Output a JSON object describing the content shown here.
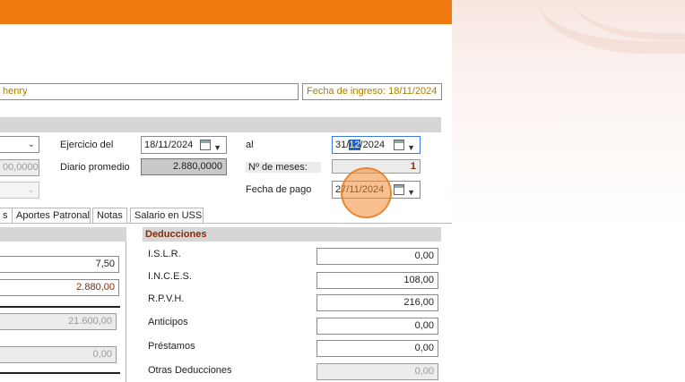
{
  "header": {
    "employee_name_partial": "henry",
    "hire_date_label": "Fecha de ingreso: 18/11/2024"
  },
  "top_left": {
    "amount_partial": "00,0000"
  },
  "period": {
    "ejercicio_label": "Ejercicio del",
    "ejercicio_value": "18/11/2024",
    "al_label": "al",
    "al_value_day": "31/",
    "al_value_month": "12",
    "al_value_year": "/2024",
    "diario_label": "Diario promedio",
    "diario_value": "2.880,0000",
    "meses_label": "Nº de meses:",
    "meses_value": "1",
    "fecha_pago_label": "Fecha de pago",
    "fecha_pago_value": "27/11/2024"
  },
  "tabs": [
    {
      "label": "s"
    },
    {
      "label": "Aportes Patronal"
    },
    {
      "label": "Notas"
    },
    {
      "label": "Salario en USS"
    }
  ],
  "left_panel": {
    "days_value": "7,50",
    "salary_value": "2.880,00",
    "subtotal_value": "21.600,00",
    "other_value": "0,00"
  },
  "deducciones": {
    "title": "Deducciones",
    "rows": [
      {
        "label": "I.S.L.R.",
        "value": "0,00"
      },
      {
        "label": "I.N.C.E.S.",
        "value": "108,00"
      },
      {
        "label": "R.P.V.H.",
        "value": "216,00"
      },
      {
        "label": "Anticipos",
        "value": "0,00"
      },
      {
        "label": "Préstamos",
        "value": "0,00"
      },
      {
        "label": "Otras Deducciones",
        "value": "0,00"
      }
    ]
  },
  "colors": {
    "accent_orange": "#f07a10",
    "section_header_text": "#8a2a06",
    "hire_date_text": "#a87e00"
  }
}
